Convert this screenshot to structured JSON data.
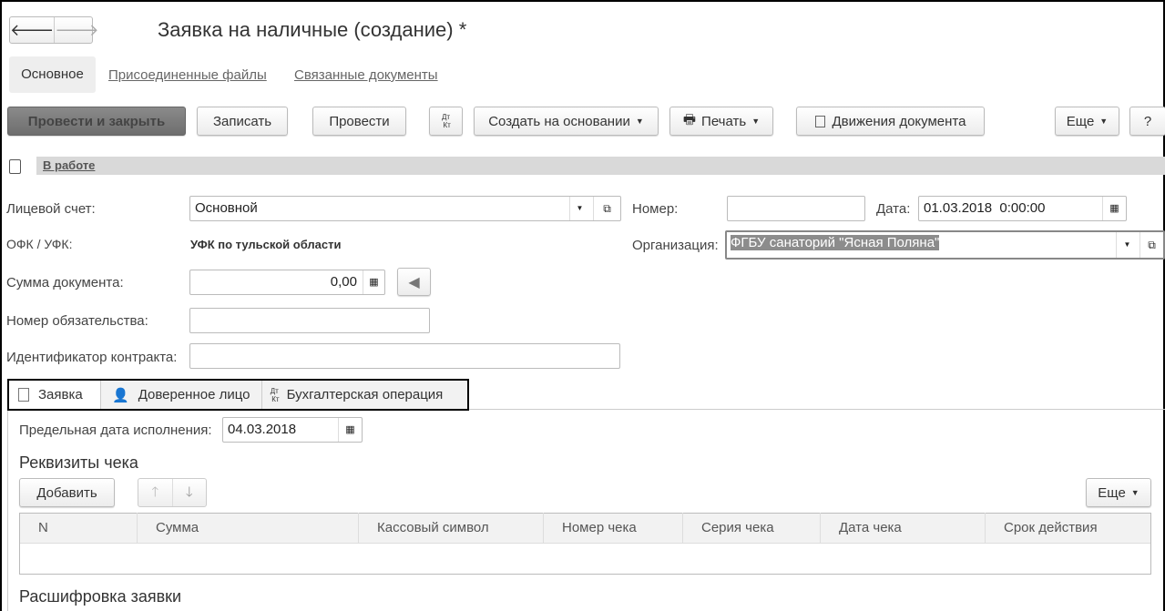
{
  "window": {
    "title": "Заявка на наличные (создание) *"
  },
  "nav": {
    "back": "🡐",
    "forward": "🡒"
  },
  "tabs": [
    {
      "label": "Основное",
      "active": true
    },
    {
      "label": "Присоединенные файлы"
    },
    {
      "label": "Связанные документы"
    }
  ],
  "toolbar": {
    "post_close": "Провести и закрыть",
    "save": "Записать",
    "post": "Провести",
    "dt": "Дт",
    "kt": "Кт",
    "create_based": "Создать на основании",
    "print": "Печать",
    "movements": "Движения документа",
    "more": "Еще",
    "help": "?"
  },
  "status": {
    "label": "В работе"
  },
  "form": {
    "account_label": "Лицевой счет:",
    "account_value": "Основной",
    "number_label": "Номер:",
    "number_value": "",
    "date_label": "Дата:",
    "date_value": "01.03.2018  0:00:00",
    "ofk_label": "ОФК / УФК:",
    "ofk_value": "УФК по тульской области",
    "org_label": "Организация:",
    "org_value": "ФГБУ санаторий \"Ясная Поляна\"",
    "sum_label": "Сумма документа:",
    "sum_value": "0,00",
    "obligation_label": "Номер обязательства:",
    "obligation_value": "",
    "contract_label": "Идентификатор контракта:",
    "contract_value": ""
  },
  "subtabs": [
    {
      "label": "Заявка"
    },
    {
      "label": "Доверенное лицо"
    },
    {
      "label": "Бухгалтерская операция"
    }
  ],
  "request": {
    "deadline_label": "Предельная дата исполнения:",
    "deadline_value": "04.03.2018",
    "checks_title": "Реквизиты чека",
    "add": "Добавить",
    "more": "Еще",
    "columns": [
      "N",
      "Сумма",
      "Кассовый символ",
      "Номер чека",
      "Серия чека",
      "Дата чека",
      "Срок действия"
    ],
    "breakdown_title": "Расшифровка заявки"
  },
  "colors": {
    "primary_button": "#7a7a7a",
    "status_bar": "#d9d9d9",
    "selection": "#8c8c8c"
  }
}
